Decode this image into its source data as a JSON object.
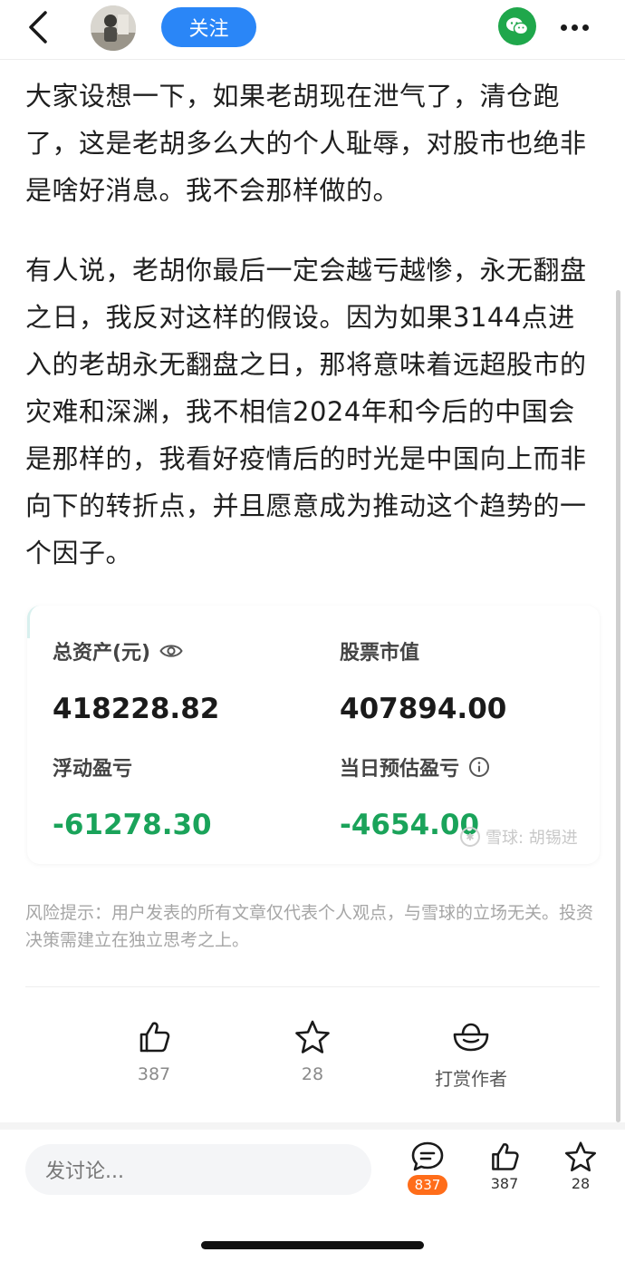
{
  "header": {
    "back_icon": "chevron-left-icon",
    "avatar_icon": "user-avatar",
    "follow_label": "关注",
    "share_icon": "wechat-icon",
    "more_icon": "more-horizontal-icon",
    "accent_color": "#2a86f7"
  },
  "article": {
    "paragraphs": [
      "大家设想一下，如果老胡现在泄气了，清仓跑了，这是老胡多么大的个人耻辱，对股市也绝非是啥好消息。我不会那样做的。",
      "有人说，老胡你最后一定会越亏越惨，永无翻盘之日，我反对这样的假设。因为如果3144点进入的老胡永无翻盘之日，那将意味着远超股市的灾难和深渊，我不相信2024年和今后的中国会是那样的，我看好疫情后的时光是中国向上而非向下的转折点，并且愿意成为推动这个趋势的一个因子。"
    ]
  },
  "asset_card": {
    "total_assets_label": "总资产(元)",
    "total_assets_value": "418228.82",
    "stock_value_label": "股票市值",
    "stock_value_value": "407894.00",
    "floating_pl_label": "浮动盈亏",
    "floating_pl_value": "-61278.30",
    "daily_pl_label": "当日预估盈亏",
    "daily_pl_value": "-4654.00",
    "loss_color": "#1aa35a",
    "watermark": "雪球: 胡锡进"
  },
  "risk_notice": "风险提示：用户发表的所有文章仅代表个人观点，与雪球的立场无关。投资决策需建立在独立思考之上。",
  "actions": {
    "like_count": "387",
    "favorite_count": "28",
    "reward_label": "打赏作者"
  },
  "bottom_bar": {
    "comment_placeholder": "发讨论...",
    "comment_count": "837",
    "like_count": "387",
    "favorite_count": "28"
  }
}
